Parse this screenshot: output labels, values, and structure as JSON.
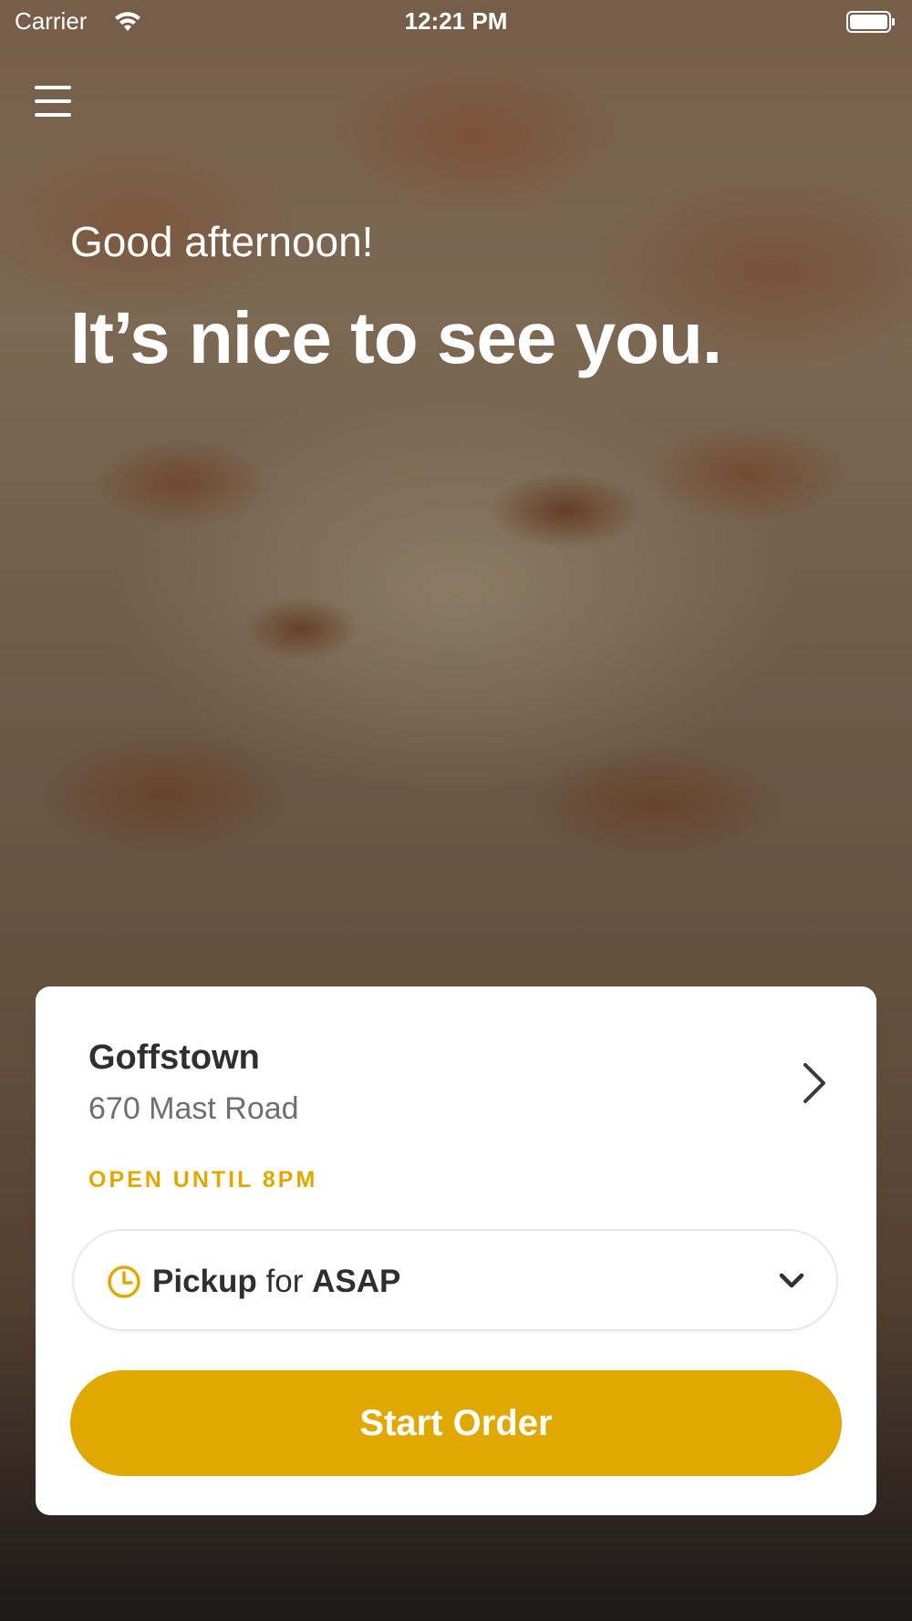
{
  "status_bar": {
    "carrier": "Carrier",
    "time": "12:21 PM"
  },
  "header": {
    "menu_icon": "hamburger-menu-icon"
  },
  "hero": {
    "greeting": "Good afternoon!",
    "headline": "It’s nice to see you."
  },
  "location": {
    "name": "Goffstown",
    "address": "670 Mast Road",
    "status": "OPEN UNTIL 8PM"
  },
  "order": {
    "mode": "Pickup",
    "connector": "for",
    "time": "ASAP",
    "start_label": "Start Order"
  },
  "colors": {
    "accent": "#e0a800",
    "text_dark": "#2f2f2f",
    "text_muted": "#6f6f6f"
  }
}
